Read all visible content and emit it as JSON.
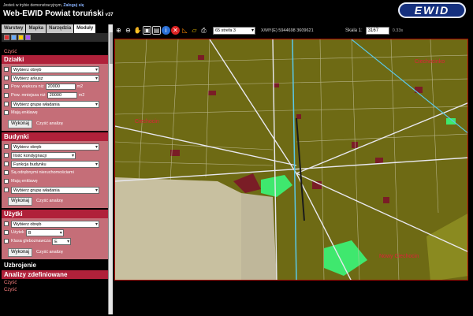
{
  "header": {
    "demo_text": "Jesteś w trybie demonstracyjnym,",
    "login_link": "Zaloguj się",
    "title": "Web-EWID Powiat toruński",
    "version": "v37",
    "logo": "EWID"
  },
  "tabs": [
    "Warstwy",
    "Mapka",
    "Narzędzia",
    "Moduły"
  ],
  "tabs_active_index": 3,
  "sidebar": {
    "clear_top": "Czyść",
    "dzialki": {
      "title": "Działki",
      "obreb": "Wybierz obręb",
      "arkusz": "Wybierz arkusz",
      "pow_wieksza_label": "Pow. większa niż",
      "pow_wieksza_value": "20000",
      "pow_mniejsza_label": "Pow. mniejsza niż",
      "pow_mniejsza_value": "20000",
      "unit": "m2",
      "grupa": "Wybierz grupę władania",
      "maja_enklawe": "Mają enklawę",
      "execute": "Wykonaj",
      "clear": "Czyść analizę"
    },
    "budynki": {
      "title": "Budynki",
      "obreb": "Wybierz obręb",
      "kondygnacji": "Ilość kondygnacji",
      "funkcja": "Funkcja budynku",
      "sa_odrebnymi": "Są odrębnymi nieruchomościami",
      "maja_enklawe": "Mają enklawę",
      "grupa": "Wybierz grupę władania",
      "execute": "Wykonaj",
      "clear": "Czyść analizę"
    },
    "uzytki": {
      "title": "Użytki",
      "obreb": "Wybierz obręb",
      "uzytek_label": "Użytek",
      "uzytek_value": "B",
      "klasa_label": "Klasa gleboznawcza",
      "klasa_value": "E",
      "execute": "Wykonaj",
      "clear": "Czyść analizę"
    },
    "uzbrojenie": "Uzbrojenie",
    "analizy": "Analizy zdefiniowane",
    "clear_1": "Czyść",
    "clear_2": "Czyść"
  },
  "toolbar": {
    "layer_select": "65 strefa 3",
    "coords": "X/MY(E) 5944698 3609621",
    "scale_label": "Skala 1:",
    "scale_value": "3167",
    "time": "0.33s"
  },
  "map": {
    "labels": [
      "Ciechocinko",
      "Ciechocin",
      "Nowy Ciechocin"
    ],
    "colors": {
      "land": "#6e6a14",
      "roads": "#e8e8f0",
      "field": "#c8c0a0",
      "green": "#3fe86e",
      "brown": "#7a1d26",
      "rail": "#5ac8e8"
    }
  },
  "colors": {
    "section_header": "#b0213a",
    "section_body": "#c56e78",
    "logo": "#15307e"
  }
}
